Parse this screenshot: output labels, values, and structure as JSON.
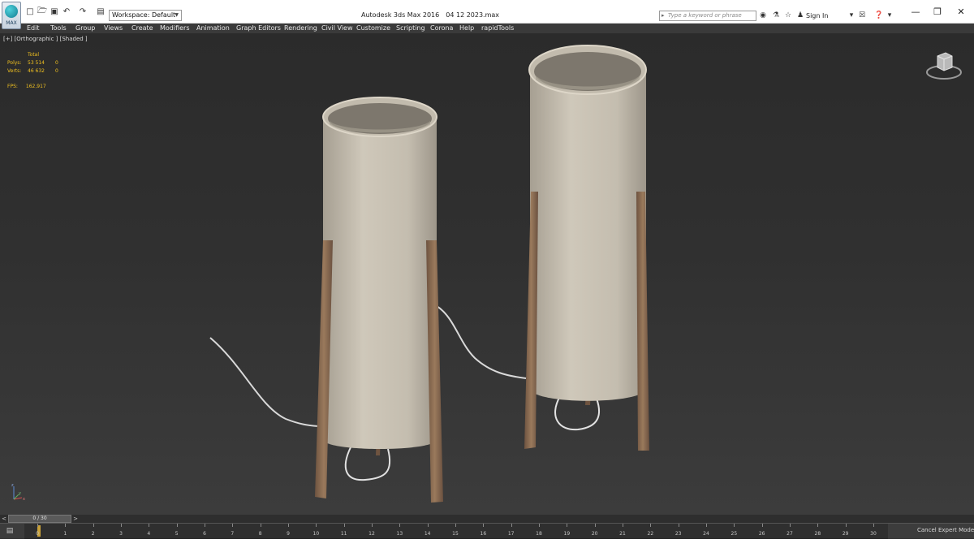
{
  "titlebar": {
    "app_logo_caption": "MAX",
    "workspace_label": "Workspace: Default",
    "app_name": "Autodesk 3ds Max 2016",
    "file_name": "04 12 2023.max",
    "search_placeholder": "Type a keyword or phrase",
    "sign_in_label": "Sign In",
    "quick_access_icons": [
      "new-file-icon",
      "open-file-icon",
      "save-icon",
      "undo-icon",
      "redo-icon",
      "project-folder-icon"
    ],
    "window_controls": [
      "minimize",
      "restore",
      "close"
    ]
  },
  "menu": {
    "items": [
      "Edit",
      "Tools",
      "Group",
      "Views",
      "Create",
      "Modifiers",
      "Animation",
      "Graph Editors",
      "Rendering",
      "Civil View",
      "Customize",
      "Scripting",
      "Corona",
      "Help",
      "rapidTools"
    ]
  },
  "viewport": {
    "label": "[+] [Orthographic ] [Shaded ]",
    "stats": {
      "header": "Total",
      "rows": [
        {
          "label": "Polys:",
          "total": "53 514",
          "selected": "0"
        },
        {
          "label": "Verts:",
          "total": "46 632",
          "selected": "0"
        }
      ],
      "fps_label": "FPS:",
      "fps_value": "162,917"
    },
    "axis_labels": {
      "z": "z",
      "y": "y",
      "x": "x"
    }
  },
  "timeline": {
    "slider_value": "0 / 30",
    "prev_arrow": "<",
    "next_arrow": ">",
    "frames": [
      "0",
      "1",
      "2",
      "3",
      "4",
      "5",
      "6",
      "7",
      "8",
      "9",
      "10",
      "11",
      "12",
      "13",
      "14",
      "15",
      "16",
      "17",
      "18",
      "19",
      "20",
      "21",
      "22",
      "23",
      "24",
      "25",
      "26",
      "27",
      "28",
      "29",
      "30"
    ],
    "cancel_expert_mode": "Cancel Expert Mode"
  },
  "colors": {
    "viewport_bg": "#303030",
    "menu_bg": "#3a3a3a",
    "stats_text": "#f0c020",
    "lampshade": "#c9c2b4",
    "wood": "#8a6a4e"
  }
}
